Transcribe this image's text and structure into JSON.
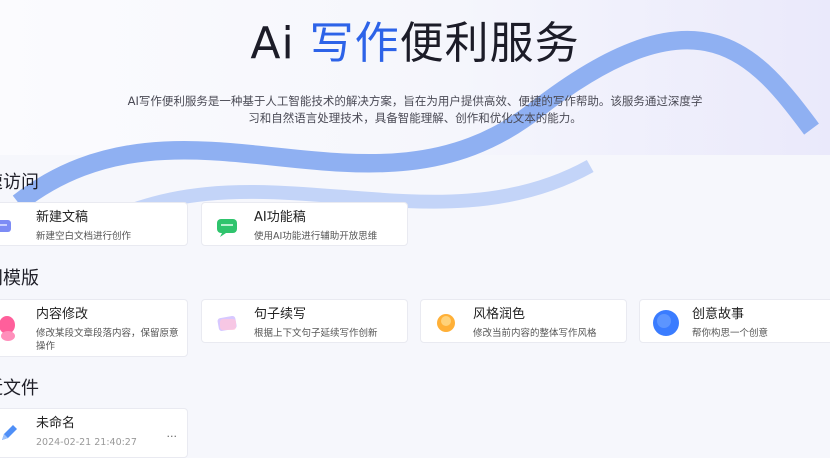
{
  "hero": {
    "title_prefix": "Ai ",
    "title_highlight": "写作",
    "title_suffix": "便利服务",
    "description": "AI写作便利服务是一种基于人工智能技术的解决方案，旨在为用户提供高效、便捷的写作帮助。该服务通过深度学习和自然语言处理技术，具备智能理解、创作和优化文本的能力。"
  },
  "quick_access": {
    "title": "速访问",
    "items": [
      {
        "name": "新建文稿",
        "desc": "新建空白文档进行创作",
        "icon": "doc-new-icon"
      },
      {
        "name": "AI功能稿",
        "desc": "使用AI功能进行辅助开放思维",
        "icon": "ai-chat-icon"
      }
    ]
  },
  "templates": {
    "title": "门模版",
    "items": [
      {
        "name": "内容修改",
        "desc": "修改某段文章段落内容，保留原意操作",
        "icon": "edit-content-icon"
      },
      {
        "name": "句子续写",
        "desc": "根据上下文句子延续写作创新",
        "icon": "sentence-continue-icon"
      },
      {
        "name": "风格润色",
        "desc": "修改当前内容的整体写作风格",
        "icon": "style-polish-icon"
      },
      {
        "name": "创意故事",
        "desc": "帮你构思一个创意",
        "icon": "creative-story-icon"
      }
    ]
  },
  "recent": {
    "title": "近文件",
    "files": [
      {
        "name": "未命名",
        "time": "2024-02-21 21:40:27",
        "icon": "pencil-icon",
        "more": "..."
      }
    ]
  },
  "colors": {
    "accent": "#2d63e8",
    "background": "#f6f7fc"
  }
}
